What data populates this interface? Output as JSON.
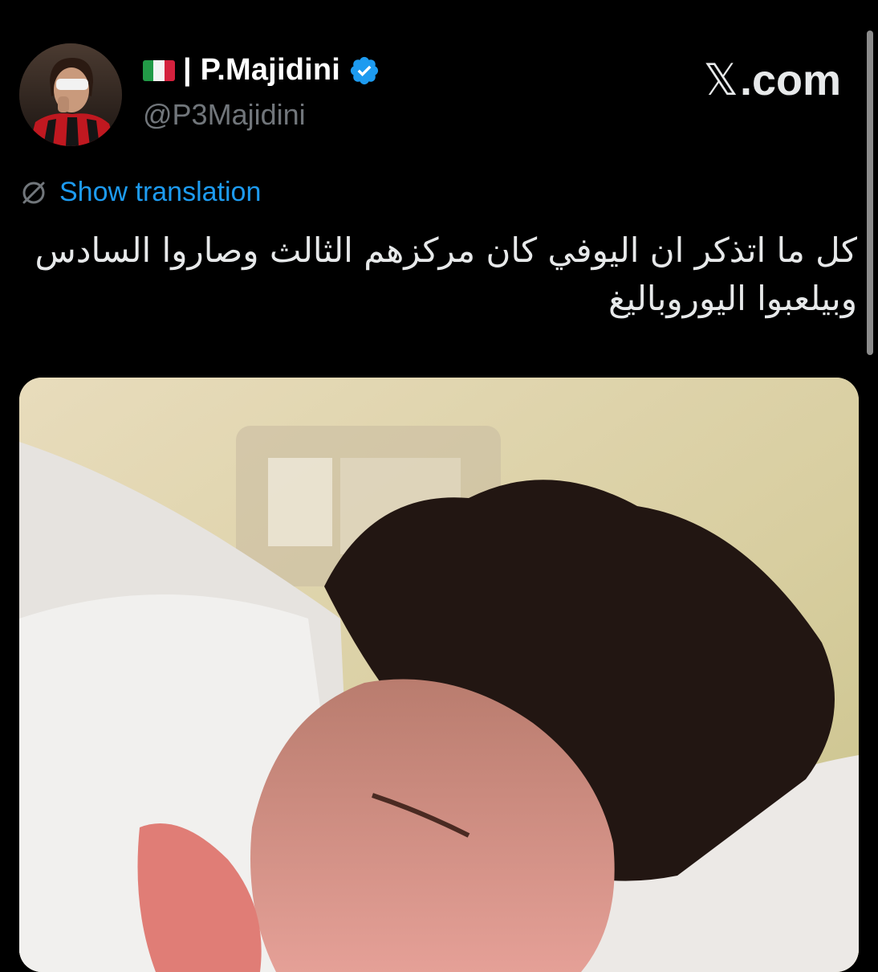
{
  "header": {
    "display_name": "| P.Majidini",
    "handle": "@P3Majidini",
    "flag_icon": "italy-flag-icon",
    "verified_icon": "verified-badge-icon",
    "verified_color": "#1d9bf0"
  },
  "brand": {
    "logo_glyph": "𝕏",
    "domain": ".com"
  },
  "translation": {
    "icon": "globe-slash-icon",
    "label": "Show translation"
  },
  "tweet": {
    "text": "كل ما اتذكر ان اليوفي كان مركزهم الثالث وصاروا السادس وبيلعبوا اليوروباليغ"
  },
  "media": {
    "type": "video-thumbnail"
  },
  "colors": {
    "background": "#000000",
    "accent": "#1d9bf0",
    "secondary_text": "#71767b"
  }
}
